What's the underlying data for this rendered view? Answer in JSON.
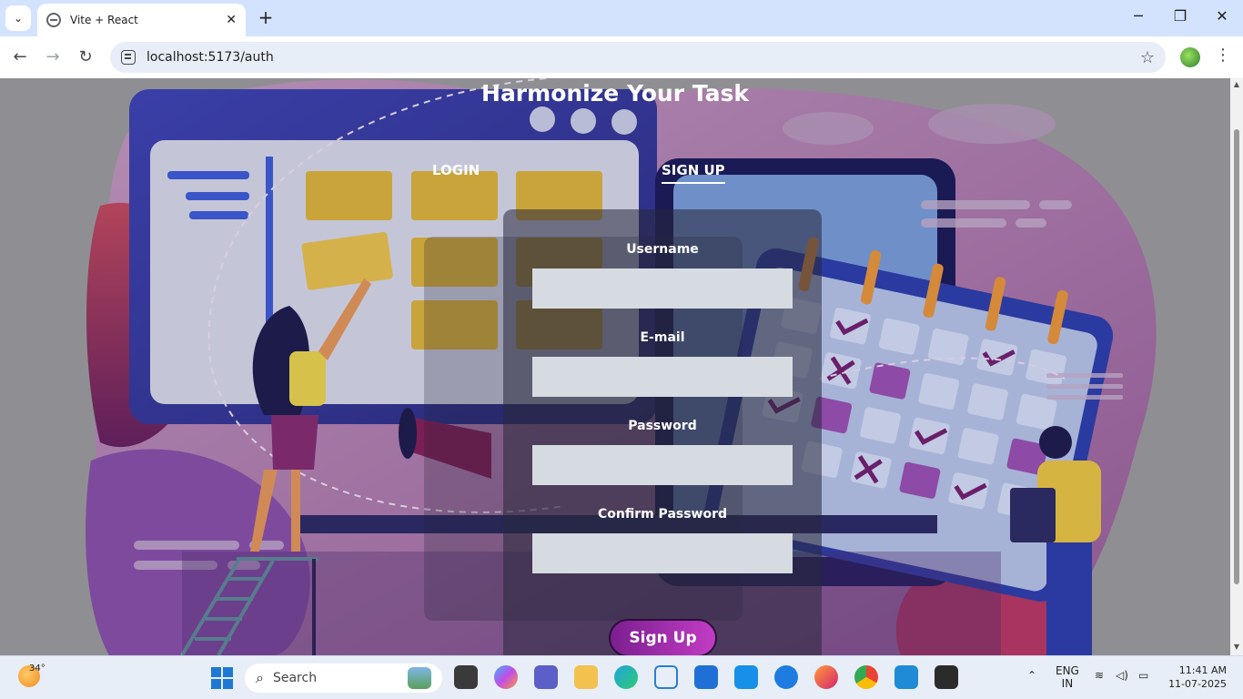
{
  "browser": {
    "tab_title": "Vite + React",
    "url": "localhost:5173/auth"
  },
  "page": {
    "heading": "Harmonize Your Task",
    "tabs": [
      {
        "label": "LOGIN",
        "active": false
      },
      {
        "label": "SIGN UP",
        "active": true
      }
    ],
    "form": {
      "fields": [
        {
          "label": "Username",
          "value": ""
        },
        {
          "label": "E-mail",
          "value": ""
        },
        {
          "label": "Password",
          "value": ""
        },
        {
          "label": "Confirm Password",
          "value": ""
        }
      ],
      "submit_label": "Sign Up"
    }
  },
  "taskbar": {
    "weather_temp": "34°",
    "search_placeholder": "Search",
    "language": "ENG",
    "region": "IN",
    "time": "11:41 AM",
    "date": "11-07-2025"
  },
  "colors": {
    "accent_purple": "#9b2fb0",
    "field_bg": "#d5dbe0",
    "chrome_blue": "#d3e3fd"
  }
}
